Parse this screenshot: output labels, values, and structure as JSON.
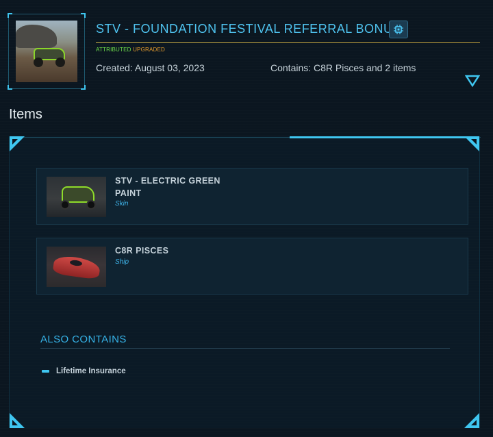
{
  "pledge": {
    "title": "STV - FOUNDATION FESTIVAL REFERRAL BONUS",
    "status_attributed": "ATTRIBUTED",
    "status_upgraded": "UPGRADED",
    "created": "Created: August 03, 2023",
    "contains": "Contains: C8R Pisces and 2 items",
    "badge_icon": "chip-icon",
    "toggle_icon": "chevron-down-triangle-icon"
  },
  "items_section": {
    "heading": "Items",
    "items": [
      {
        "name": "STV - ELECTRIC GREEN PAINT",
        "type": "Skin",
        "thumb_icon": "stv-vehicle-image"
      },
      {
        "name": "C8R PISCES",
        "type": "Ship",
        "thumb_icon": "pisces-ship-image"
      }
    ]
  },
  "also_contains": {
    "heading": "ALSO CONTAINS",
    "items": [
      "Lifetime Insurance"
    ]
  },
  "colors": {
    "accent": "#3fc6f0",
    "title": "#4fc3ef",
    "attributed": "#6fe04a",
    "upgraded": "#e39a2c",
    "rule_gold": "#d2b446",
    "background": "#0b1620"
  }
}
